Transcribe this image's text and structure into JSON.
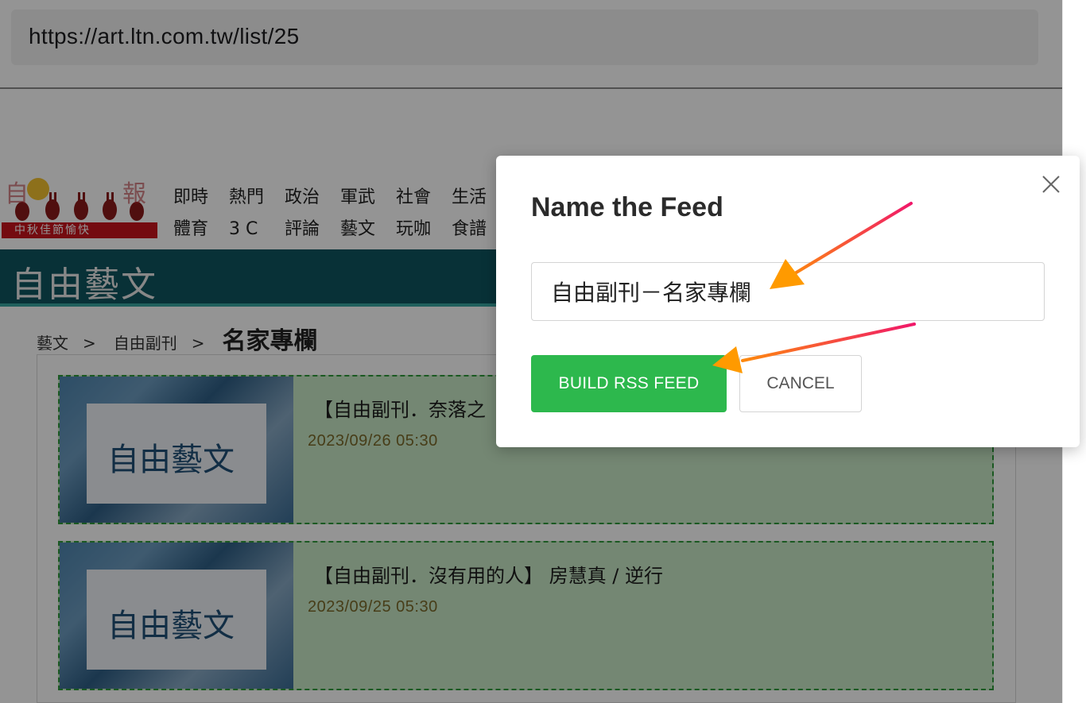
{
  "browser": {
    "url": "https://art.ltn.com.tw/list/25"
  },
  "site": {
    "logo_banner": "中秋佳節愉快",
    "nav_row1": [
      "即時",
      "熱門",
      "政治",
      "軍武",
      "社會",
      "生活"
    ],
    "nav_row2": [
      "體育",
      "3 C",
      "評論",
      "藝文",
      "玩咖",
      "食譜"
    ],
    "section_title": "自由藝文",
    "breadcrumb": {
      "level1": "藝文",
      "sep": ">",
      "level2": "自由副刊",
      "current": "名家專欄"
    },
    "articles": [
      {
        "thumb_text": "自由藝文",
        "headline": "【自由副刊．奈落之",
        "date": "2023/09/26 05:30"
      },
      {
        "thumb_text": "自由藝文",
        "headline": "【自由副刊．沒有用的人】 房慧真 / 逆行",
        "date": "2023/09/25 05:30"
      }
    ]
  },
  "modal": {
    "title": "Name the Feed",
    "feed_name_value": "自由副刊－名家專欄",
    "build_label": "BUILD RSS FEED",
    "cancel_label": "CANCEL"
  },
  "colors": {
    "accent_green": "#2db84d",
    "section_teal": "#0e5560",
    "arrow_start": "#f0186a",
    "arrow_end": "#ff9a00"
  },
  "icons": {
    "close": "close-icon"
  }
}
